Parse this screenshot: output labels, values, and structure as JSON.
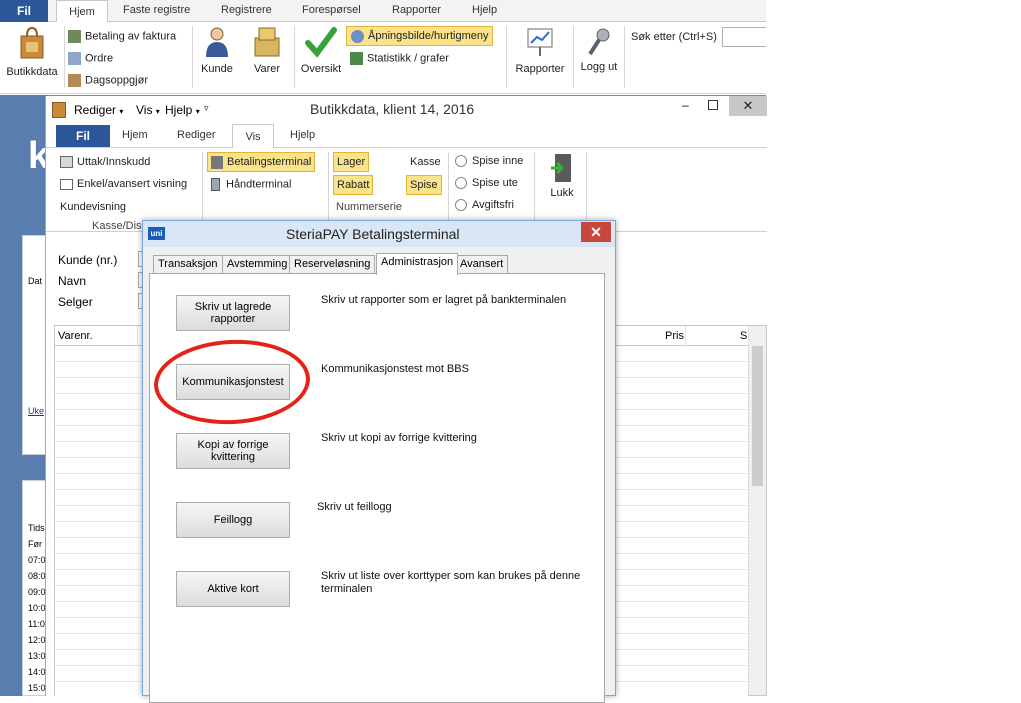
{
  "bg_app": {
    "tabs": [
      "Fil",
      "Hjem",
      "Faste registre",
      "Registrere",
      "Forespørsel",
      "Rapporter",
      "Hjelp"
    ],
    "ribbon": {
      "butikkdata": "Butikkdata",
      "betaling_faktura": "Betaling av faktura",
      "ordre": "Ordre",
      "dagsoppgjor": "Dagsoppgjør",
      "kunde": "Kunde",
      "varer": "Varer",
      "oversikt": "Oversikt",
      "apningsbilde": "Åpningsbilde/hurtigmeny",
      "statistikk": "Statistikk / grafer",
      "rapporter": "Rapporter",
      "logg_ut": "Logg ut",
      "sok_label": "Søk etter (Ctrl+S)"
    },
    "side_labels": [
      "Dat",
      "Uke",
      "Tids",
      "Før",
      "07:0",
      "08:0",
      "09:0",
      "10:0",
      "11:0",
      "12:0",
      "13:0",
      "14:0",
      "15:0"
    ]
  },
  "win2": {
    "qat": {
      "rediger": "Rediger",
      "vis": "Vis",
      "hjelp": "Hjelp"
    },
    "title": "Butikkdata, klient 14, 2016",
    "tabs": [
      "Fil",
      "Hjem",
      "Rediger",
      "Vis",
      "Hjelp"
    ],
    "ribbon": {
      "uttak": "Uttak/Innskudd",
      "enkel": "Enkel/avansert visning",
      "kundevisning": "Kundevisning",
      "group_kasse": "Kasse/Dis",
      "betalingsterminal": "Betalingsterminal",
      "handterminal": "Håndterminal",
      "lager": "Lager",
      "kasse": "Kasse",
      "rabatt": "Rabatt",
      "spise": "Spise",
      "nummerserie": "Nummerserie",
      "spise_inne": "Spise inne",
      "spise_ute": "Spise ute",
      "avgiftsfri": "Avgiftsfri",
      "lukk": "Lukk"
    },
    "form": {
      "kunde": "Kunde (nr.)",
      "navn": "Navn",
      "selger": "Selger"
    },
    "grid_headers": {
      "varenr": "Varenr.",
      "pris": "Pris",
      "sum": "Su"
    }
  },
  "dialog": {
    "logo": "uni",
    "title": "SteriaPAY Betalingsterminal",
    "close": "✕",
    "tabs": [
      "Transaksjon",
      "Avstemming",
      "Reserveløsning",
      "Administrasjon",
      "Avansert"
    ],
    "active_tab": "Administrasjon",
    "actions": [
      {
        "button": "Skriv ut lagrede rapporter",
        "desc": "Skriv ut rapporter som er lagret på bankterminalen"
      },
      {
        "button": "Kommunikasjonstest",
        "desc": "Kommunikasjonstest mot BBS"
      },
      {
        "button": "Kopi av forrige kvittering",
        "desc": "Skriv ut kopi av forrige kvittering"
      },
      {
        "button": "Feillogg",
        "desc": "Skriv ut feillogg"
      },
      {
        "button": "Aktive kort",
        "desc": "Skriv ut liste over korttyper som kan brukes på denne terminalen"
      }
    ]
  },
  "colors": {
    "fil_blue": "#2b579a",
    "highlight": "#fbe38c",
    "ellipse": "#e2231a",
    "side_blue": "#5a7db0"
  }
}
